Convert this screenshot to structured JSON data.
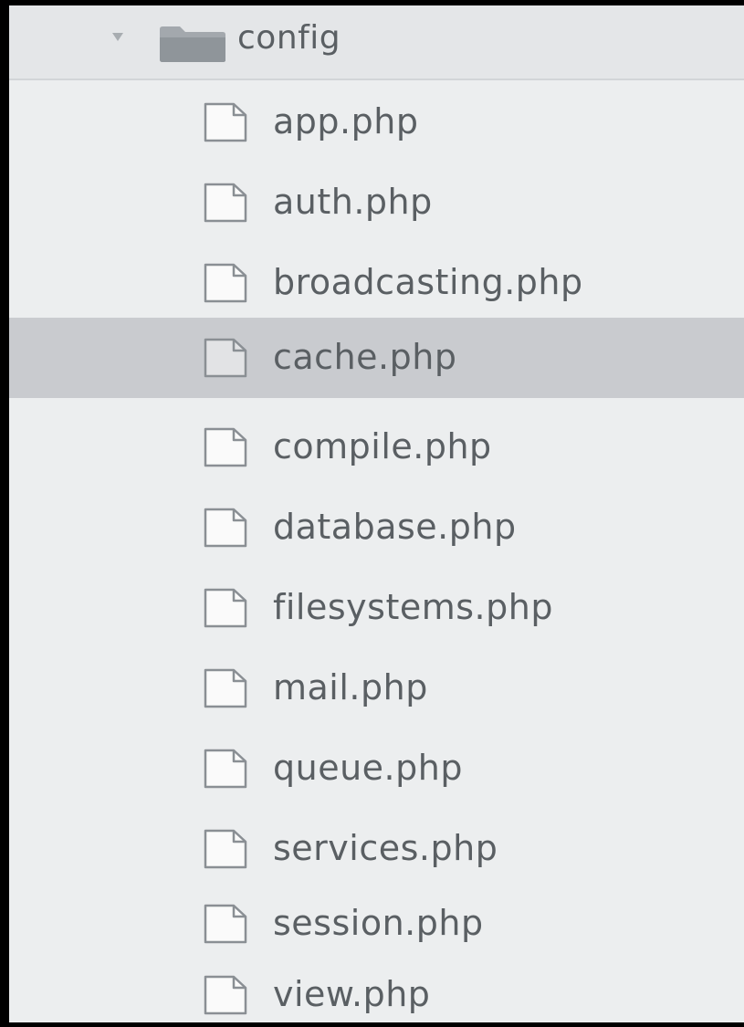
{
  "tree": {
    "folder": {
      "label": "config",
      "expanded": true,
      "chevron_icon": "chevron-down-icon",
      "icon": "folder-icon"
    },
    "selected_index": 3,
    "files": [
      {
        "label": "app.php",
        "icon": "file-icon"
      },
      {
        "label": "auth.php",
        "icon": "file-icon"
      },
      {
        "label": "broadcasting.php",
        "icon": "file-icon"
      },
      {
        "label": "cache.php",
        "icon": "file-icon"
      },
      {
        "label": "compile.php",
        "icon": "file-icon"
      },
      {
        "label": "database.php",
        "icon": "file-icon"
      },
      {
        "label": "filesystems.php",
        "icon": "file-icon"
      },
      {
        "label": "mail.php",
        "icon": "file-icon"
      },
      {
        "label": "queue.php",
        "icon": "file-icon"
      },
      {
        "label": "services.php",
        "icon": "file-icon"
      },
      {
        "label": "session.php",
        "icon": "file-icon"
      },
      {
        "label": "view.php",
        "icon": "file-icon"
      }
    ]
  },
  "colors": {
    "panel_background": "#eceeef",
    "folder_row_background": "#e4e6e8",
    "selected_row_background": "#c9cbcf",
    "text": "#5a5f63",
    "icon_stroke": "#8a8f94"
  }
}
